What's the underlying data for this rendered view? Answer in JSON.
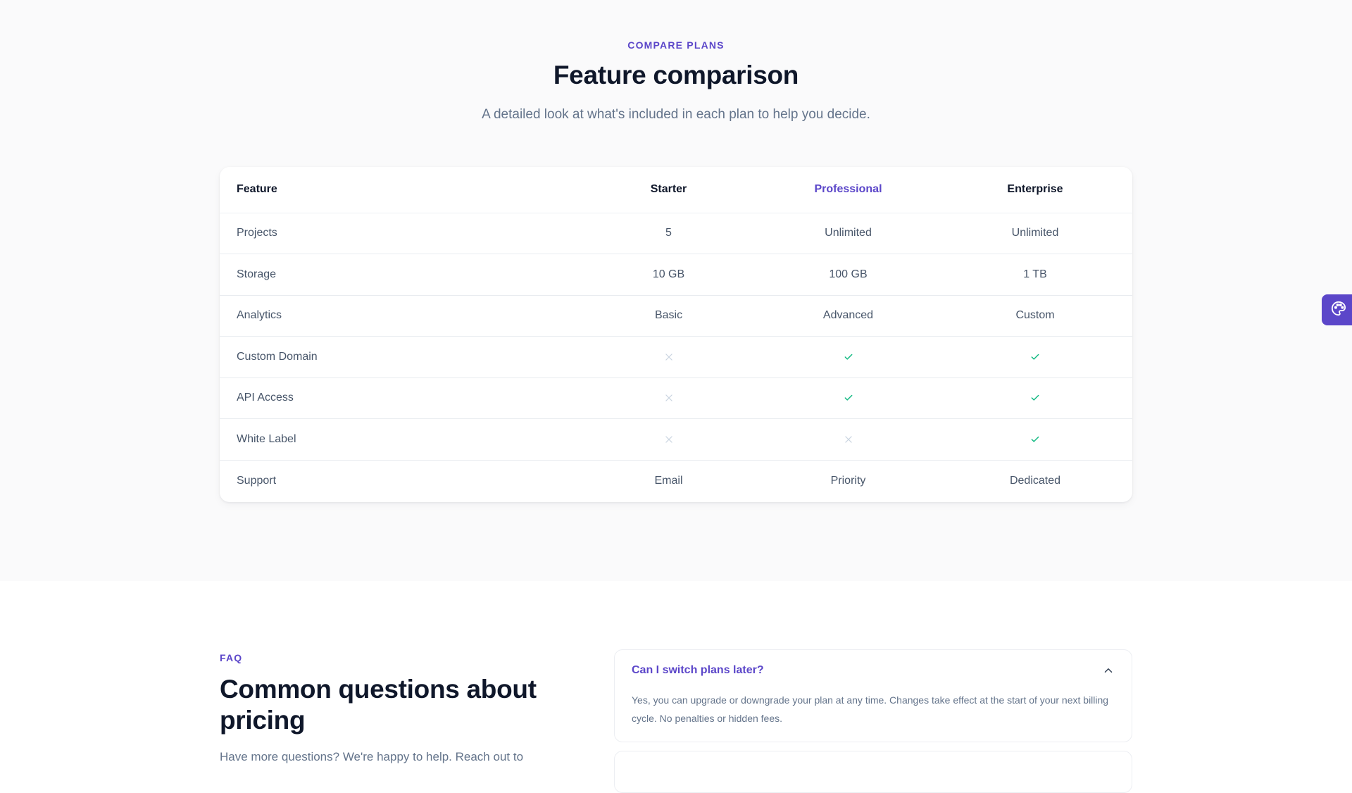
{
  "compare": {
    "eyebrow": "COMPARE PLANS",
    "title": "Feature comparison",
    "subtitle": "A detailed look at what's included in each plan to help you decide.",
    "headers": {
      "feature": "Feature",
      "starter": "Starter",
      "professional": "Professional",
      "enterprise": "Enterprise"
    },
    "rows": [
      {
        "feature": "Projects",
        "starter": "5",
        "professional": "Unlimited",
        "enterprise": "Unlimited"
      },
      {
        "feature": "Storage",
        "starter": "10 GB",
        "professional": "100 GB",
        "enterprise": "1 TB"
      },
      {
        "feature": "Analytics",
        "starter": "Basic",
        "professional": "Advanced",
        "enterprise": "Custom"
      },
      {
        "feature": "Custom Domain",
        "starter": "x-icon",
        "professional": "check-icon",
        "enterprise": "check-icon"
      },
      {
        "feature": "API Access",
        "starter": "x-icon",
        "professional": "check-icon",
        "enterprise": "check-icon"
      },
      {
        "feature": "White Label",
        "starter": "x-icon",
        "professional": "x-icon",
        "enterprise": "check-icon"
      },
      {
        "feature": "Support",
        "starter": "Email",
        "professional": "Priority",
        "enterprise": "Dedicated"
      }
    ]
  },
  "faq": {
    "eyebrow": "FAQ",
    "title": "Common questions about pricing",
    "description": "Have more questions? We're happy to help. Reach out to",
    "items": [
      {
        "question": "Can I switch plans later?",
        "answer": "Yes, you can upgrade or downgrade your plan at any time. Changes take effect at the start of your next billing cycle. No penalties or hidden fees.",
        "expanded": true
      }
    ]
  },
  "side_widget": {
    "icon": "palette-icon"
  },
  "colors": {
    "accent": "#5b46c9",
    "check": "#10b981",
    "cross": "#cbd5e1"
  }
}
